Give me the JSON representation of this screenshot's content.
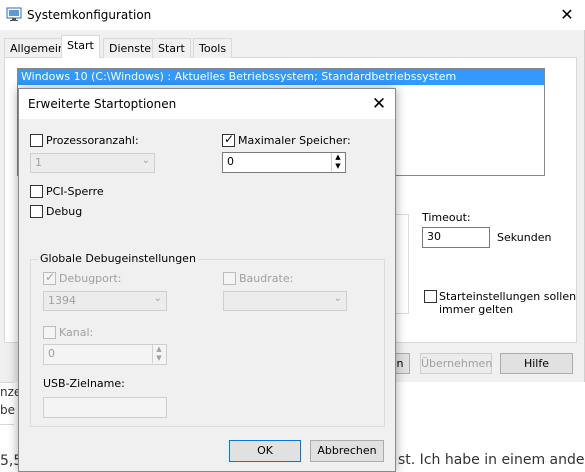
{
  "background_page": {
    "line1": "nze",
    "line2": "be",
    "line3_left": "5,5",
    "line3_right": "st. Ich habe in einem anderen"
  },
  "main_window": {
    "title": "Systemkonfiguration",
    "icon": "system-config-icon",
    "close_glyph": "✕",
    "tabs": [
      "Allgemein",
      "Start",
      "Dienste",
      "Start",
      "Tools"
    ],
    "active_tab": 1,
    "boot_entry": "Windows 10 (C:\\Windows) : Aktuelles Betriebssystem; Standardbetriebssystem",
    "timeout_label": "Timeout:",
    "timeout_value": "30",
    "timeout_unit": "Sekunden",
    "persist_label_line1": "Starteinstellungen sollen",
    "persist_label_line2": "immer gelten",
    "buttons": {
      "ok": "n",
      "apply": "Übernehmen",
      "help": "Hilfe"
    }
  },
  "dialog": {
    "title": "Erweiterte Startoptionen",
    "close_glyph": "✕",
    "processor_label": "Prozessoranzahl:",
    "processor_value": "1",
    "memory_label": "Maximaler Speicher:",
    "memory_checked": true,
    "memory_value": "0",
    "pci_label": "PCI-Sperre",
    "debug_label": "Debug",
    "group_title": "Globale Debugeinstellungen",
    "debugport_label": "Debugport:",
    "debugport_value": "1394",
    "baudrate_label": "Baudrate:",
    "baudrate_value": "",
    "channel_label": "Kanal:",
    "channel_value": "0",
    "usb_label": "USB-Zielname:",
    "usb_value": "",
    "ok": "OK",
    "cancel": "Abbrechen"
  },
  "colors": {
    "selection": "#3399ff",
    "focus_border": "#0078d7",
    "dialog_bg": "#f0f0f0"
  }
}
